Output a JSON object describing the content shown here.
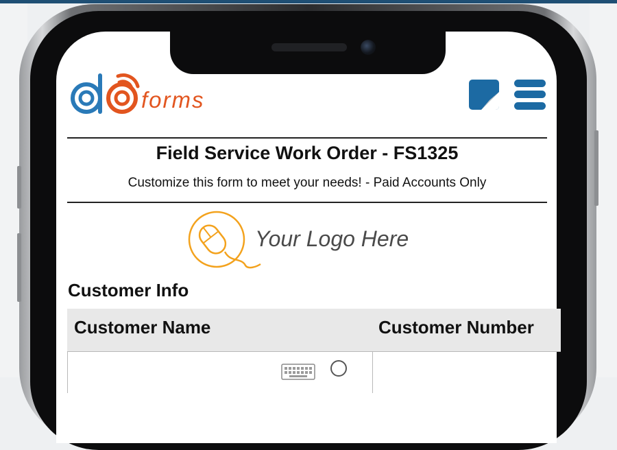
{
  "app": {
    "brand": "forms",
    "brand_colors": {
      "blue": "#2a7ab8",
      "orange": "#e2551f"
    }
  },
  "header": {
    "edit_icon": "edit-note-icon",
    "menu_icon": "hamburger-menu-icon"
  },
  "form": {
    "title": "Field Service Work Order - FS1325",
    "subtitle": "Customize this form to meet your needs! - Paid Accounts Only",
    "logo_placeholder": "Your Logo Here",
    "logo_icon": "mouse-icon",
    "logo_color": "#f3a21d"
  },
  "section": {
    "title": "Customer Info",
    "columns": [
      "Customer Name",
      "Customer Number"
    ],
    "field_icons": [
      "keyboard-icon",
      "radio-icon"
    ]
  }
}
